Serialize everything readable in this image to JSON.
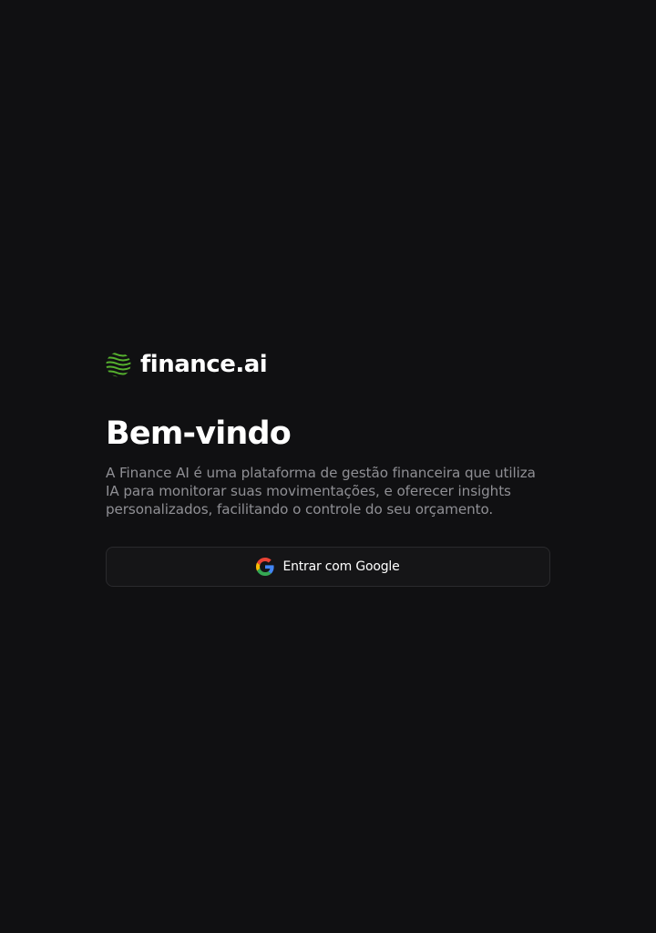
{
  "brand": {
    "name": "finance.ai",
    "logo_icon": "green-waves-icon",
    "accent_color": "#55b02e"
  },
  "welcome": {
    "title": "Bem-vindo",
    "description": "A Finance AI é uma plataforma de gestão financeira que utiliza IA para monitorar suas movimentações, e oferecer insights personalizados, facilitando o controle do seu orçamento."
  },
  "login": {
    "google_button_label": "Entrar com Google",
    "google_icon": "google-icon"
  }
}
